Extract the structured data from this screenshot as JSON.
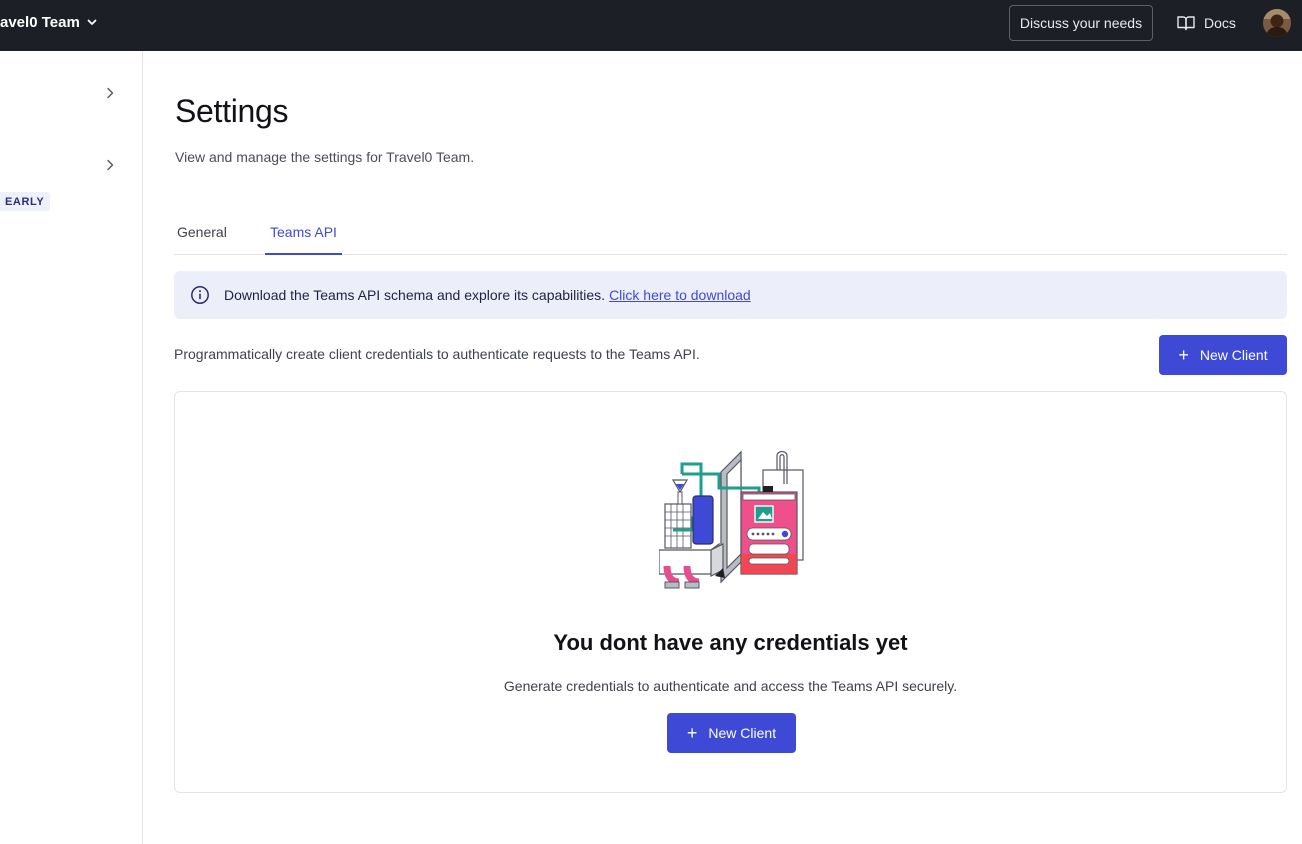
{
  "topbar": {
    "team_name": "avel0 Team",
    "discuss_label": "Discuss your needs",
    "docs_label": "Docs"
  },
  "sidebar": {
    "badge": "EARLY"
  },
  "page": {
    "title": "Settings",
    "subtitle": "View and manage the settings for Travel0 Team."
  },
  "tabs": [
    {
      "label": "General",
      "active": false
    },
    {
      "label": "Teams API",
      "active": true
    }
  ],
  "banner": {
    "text": "Download the Teams API schema and explore its capabilities.",
    "link_label": "Click here to download"
  },
  "credentials": {
    "description": "Programmatically create client credentials to authenticate requests to the Teams API.",
    "new_client_label": "New Client",
    "empty_title": "You dont have any credentials yet",
    "empty_subtitle": "Generate credentials to authenticate and access the Teams API securely.",
    "empty_button_label": "New Client"
  },
  "colors": {
    "accent": "#3e4ad6",
    "topbar_bg": "#1c1f26",
    "banner_bg": "#eceefa"
  },
  "icons": {
    "team_dropdown": "chevron-down-icon",
    "docs": "book-icon",
    "sidebar_expand": "chevron-right-icon",
    "banner": "info-icon",
    "add": "plus-icon"
  }
}
